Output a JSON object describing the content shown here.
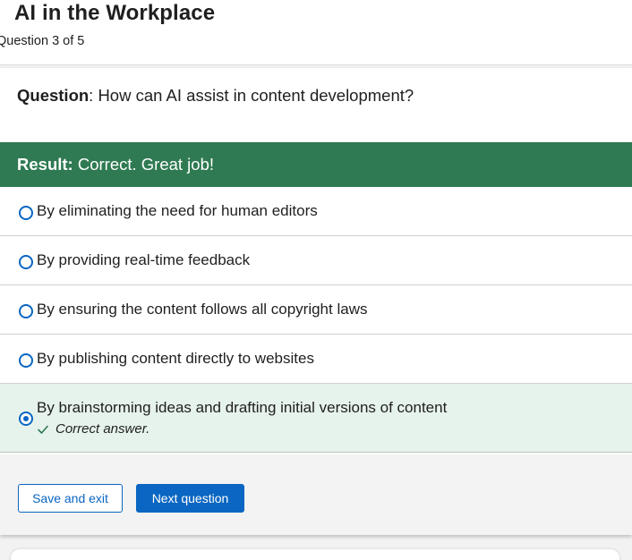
{
  "header": {
    "title": "AI in the Workplace",
    "progress": "Question 3 of 5"
  },
  "question": {
    "label": "Question",
    "text": ": How can AI assist in content development?"
  },
  "result": {
    "label": "Result:",
    "text": " Correct. Great job!",
    "color": "#2f7a52"
  },
  "options": [
    {
      "text": "By eliminating the need for human editors",
      "selected": false
    },
    {
      "text": "By providing real-time feedback",
      "selected": false
    },
    {
      "text": "By ensuring the content follows all copyright laws",
      "selected": false
    },
    {
      "text": "By publishing content directly to websites",
      "selected": false
    },
    {
      "text": "By brainstorming ideas and drafting initial versions of content",
      "selected": true,
      "feedback": "Correct answer.",
      "feedback_icon": "check-icon"
    }
  ],
  "buttons": {
    "save": "Save and exit",
    "next": "Next question"
  },
  "colors": {
    "accent": "#0a66c2",
    "selected_bg": "#e6f3ec"
  }
}
